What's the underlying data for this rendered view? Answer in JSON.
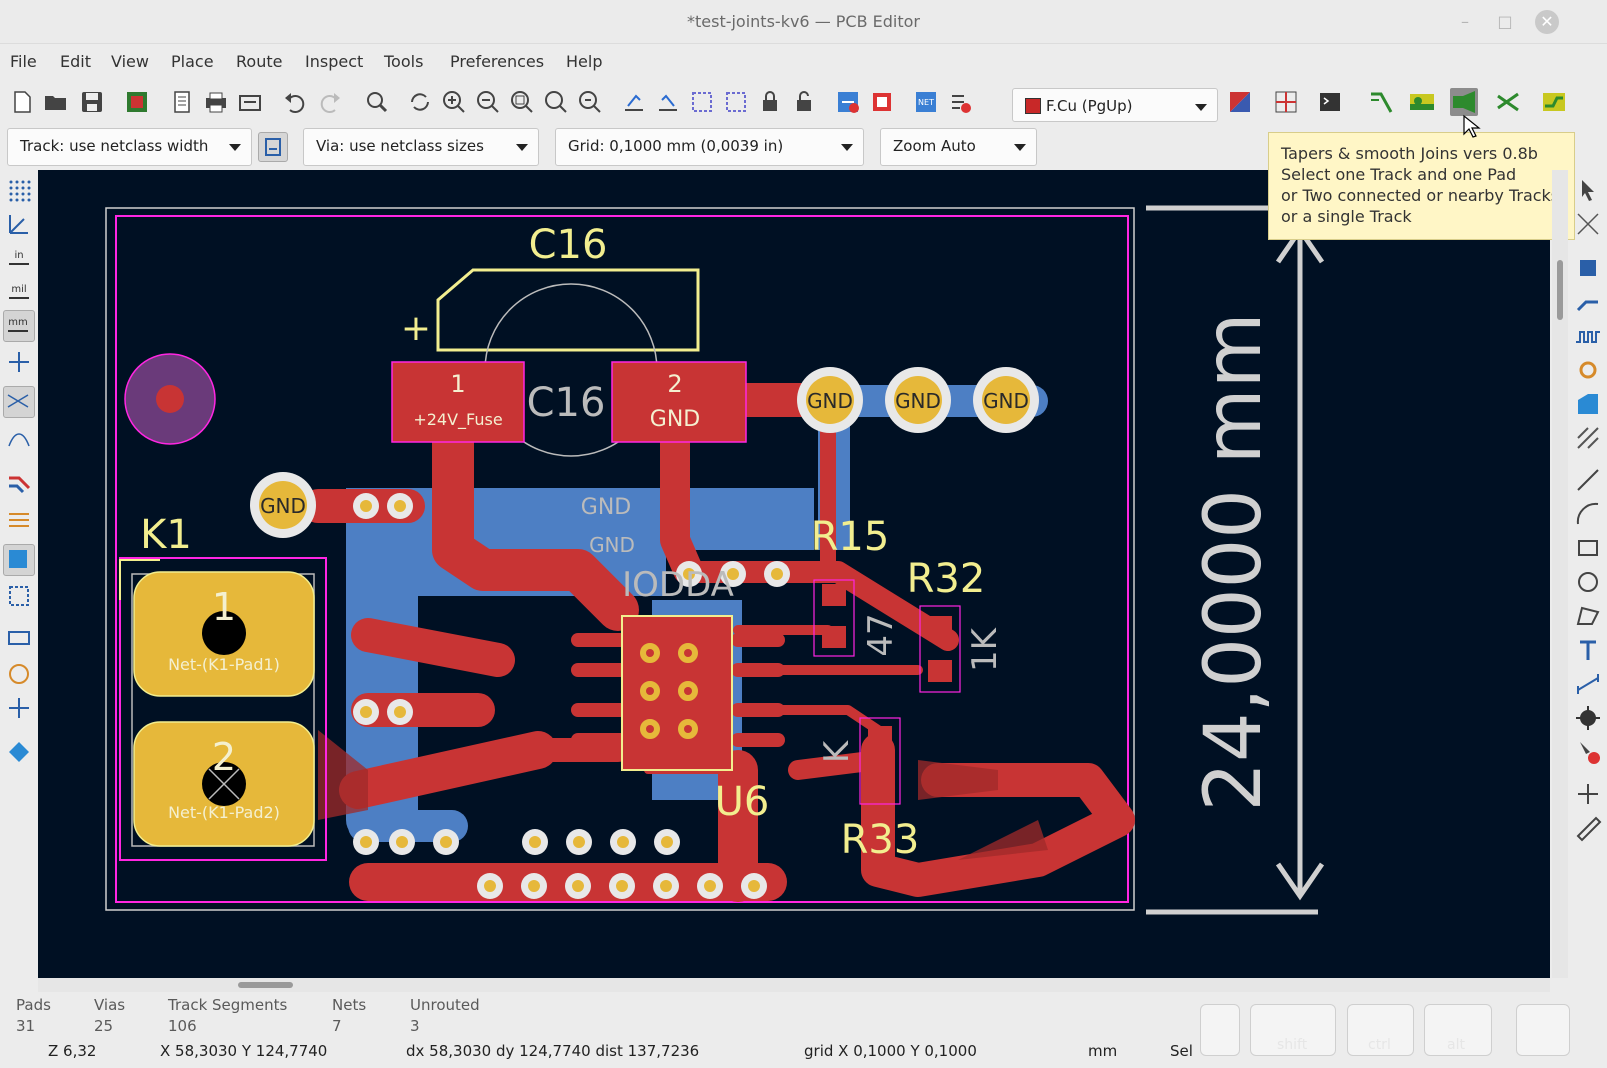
{
  "window": {
    "title": "*test-joints-kv6 — PCB Editor",
    "minimize": "–",
    "maximize": "□",
    "close": "✕"
  },
  "menu": [
    "File",
    "Edit",
    "View",
    "Place",
    "Route",
    "Inspect",
    "Tools",
    "Preferences",
    "Help"
  ],
  "toolbar": {
    "layer_select": {
      "value": "F.Cu (PgUp)",
      "color": "#c82828"
    }
  },
  "auxbar": {
    "track_width": "Track: use netclass width",
    "via_size": "Via: use netclass sizes",
    "grid": "Grid: 0,1000 mm (0,0039 in)",
    "zoom": "Zoom Auto"
  },
  "tooltip": {
    "lines": [
      "Tapers & smooth Joins vers 0.8b",
      "Select one Track and one Pad",
      "or Two connected or nearby Tracks",
      "or a single Track"
    ]
  },
  "board": {
    "colors": {
      "background": "#001023",
      "front_copper": "#c83434",
      "back_copper": "#4d7fc4",
      "pad": "#e6b83a",
      "silkscreen": "#f2ee8f",
      "courtyard": "#ff26e2",
      "edge": "#d0d0d0"
    },
    "refs": {
      "c16": "C16",
      "c16_fab": "C16",
      "k1": "K1",
      "u6": "U6",
      "r15": "R15",
      "r32": "R32",
      "r33": "R33",
      "r_value_47": "47",
      "r_value_1k": "1K",
      "k_label": "K",
      "iodd_label": "IODDA",
      "gnd_pour": "GND",
      "gnd_pour2": "GND",
      "polarity": "+"
    },
    "pads": {
      "c16_pad1_num": "1",
      "c16_pad1_net": "+24V_Fuse",
      "c16_pad2_num": "2",
      "c16_pad2_net": "GND",
      "k1_pad1_num": "1",
      "k1_pad1_net": "Net-(K1-Pad1)",
      "k1_pad2_num": "2",
      "k1_pad2_net": "Net-(K1-Pad2)",
      "gnd_via": "GND",
      "gnd_net": "GND"
    },
    "dimension": {
      "value": "24,0000 mm"
    }
  },
  "status": {
    "pads": {
      "label": "Pads",
      "value": "31"
    },
    "vias": {
      "label": "Vias",
      "value": "25"
    },
    "track_segments": {
      "label": "Track Segments",
      "value": "106"
    },
    "nets": {
      "label": "Nets",
      "value": "7"
    },
    "unrouted": {
      "label": "Unrouted",
      "value": "3"
    },
    "zoom": "Z 6,32",
    "cursor": "X 58,3030  Y 124,7740",
    "delta": "dx 58,3030  dy 124,7740  dist 137,7236",
    "grid": "grid X 0,1000  Y 0,1000",
    "units": "mm",
    "sel": "Sel",
    "keys": [
      "",
      "shift",
      "ctrl",
      "alt",
      ""
    ]
  }
}
